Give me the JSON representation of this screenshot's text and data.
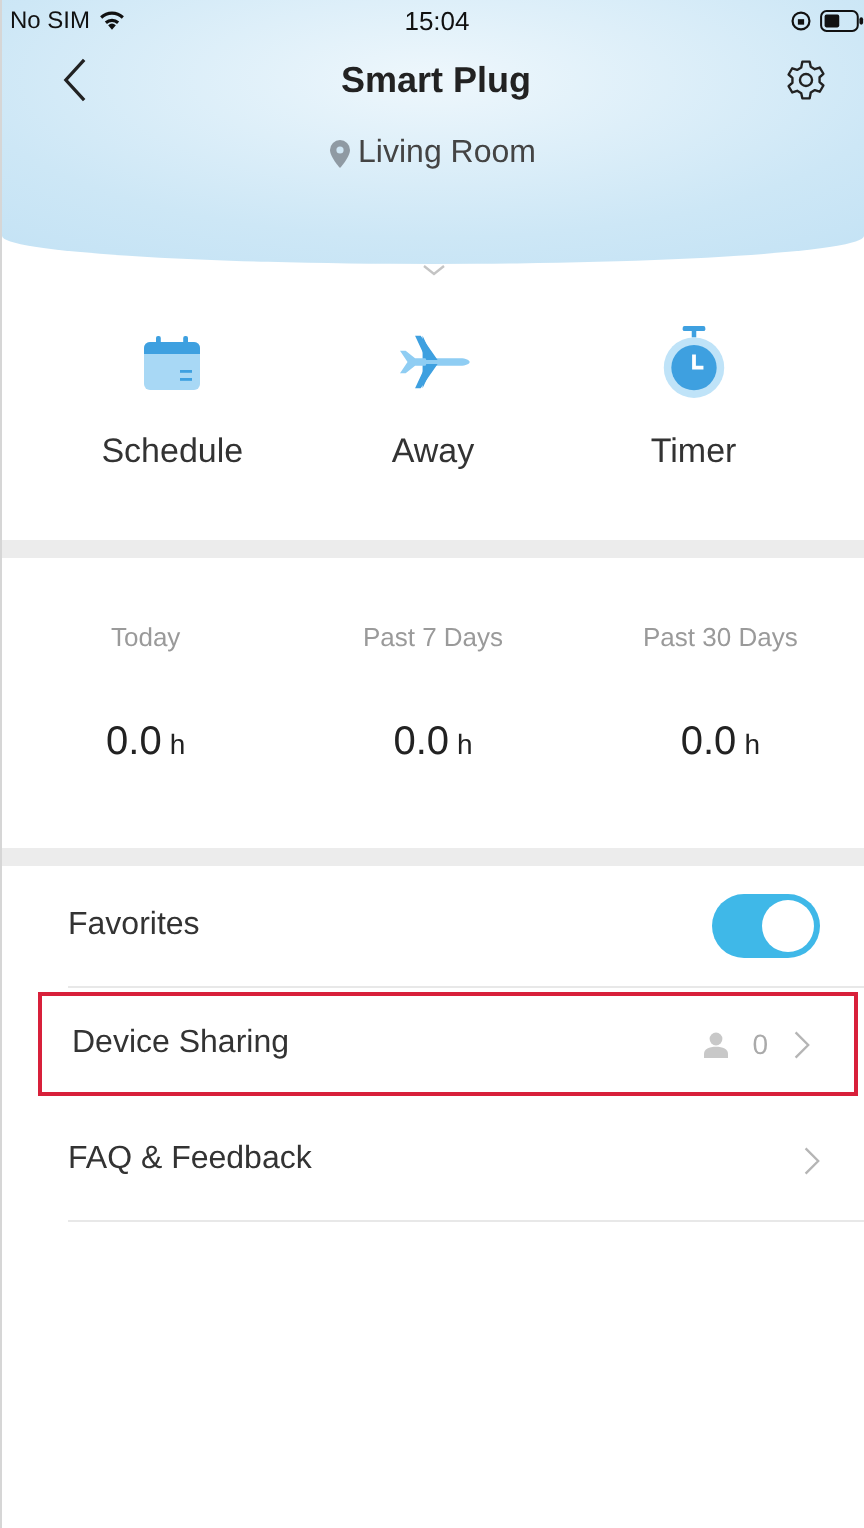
{
  "status_bar": {
    "carrier": "No SIM",
    "time": "15:04"
  },
  "header": {
    "title": "Smart Plug",
    "location": "Living Room"
  },
  "actions": [
    {
      "label": "Schedule",
      "kind": "calendar"
    },
    {
      "label": "Away",
      "kind": "plane"
    },
    {
      "label": "Timer",
      "kind": "timer"
    }
  ],
  "stats": [
    {
      "label": "Today",
      "value": "0.0",
      "unit": "h"
    },
    {
      "label": "Past 7 Days",
      "value": "0.0",
      "unit": "h"
    },
    {
      "label": "Past 30 Days",
      "value": "0.0",
      "unit": "h"
    }
  ],
  "settings": [
    {
      "label": "Favorites",
      "kind": "toggle",
      "on": true,
      "highlighted": false
    },
    {
      "label": "Device Sharing",
      "kind": "count",
      "count": "0",
      "highlighted": true
    },
    {
      "label": "FAQ & Feedback",
      "kind": "link",
      "highlighted": false
    }
  ]
}
